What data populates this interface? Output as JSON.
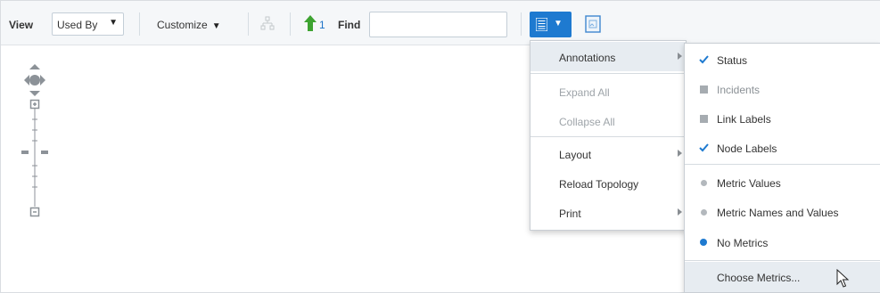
{
  "toolbar": {
    "view_label": "View",
    "view_select_value": "Used By",
    "customize_label": "Customize",
    "up_count": "1",
    "find_label": "Find",
    "find_value": "",
    "accent_color": "#1e7ad0"
  },
  "menu": {
    "items": [
      {
        "label": "Annotations"
      },
      {
        "label": "Expand All"
      },
      {
        "label": "Collapse All"
      },
      {
        "label": "Layout"
      },
      {
        "label": "Reload Topology"
      },
      {
        "label": "Print"
      }
    ]
  },
  "annotations_menu": {
    "items": [
      {
        "label": "Status",
        "indicator": "check"
      },
      {
        "label": "Incidents",
        "indicator": "square"
      },
      {
        "label": "Link Labels",
        "indicator": "square"
      },
      {
        "label": "Node Labels",
        "indicator": "check"
      },
      {
        "label": "Metric Values",
        "indicator": "radio-off"
      },
      {
        "label": "Metric Names and Values",
        "indicator": "radio-off"
      },
      {
        "label": "No Metrics",
        "indicator": "radio-on"
      },
      {
        "label": "Choose Metrics..."
      }
    ]
  },
  "icons": {
    "zoom_controls": "pan-zoom-control-icon",
    "cursor": "mouse-pointer-icon"
  }
}
